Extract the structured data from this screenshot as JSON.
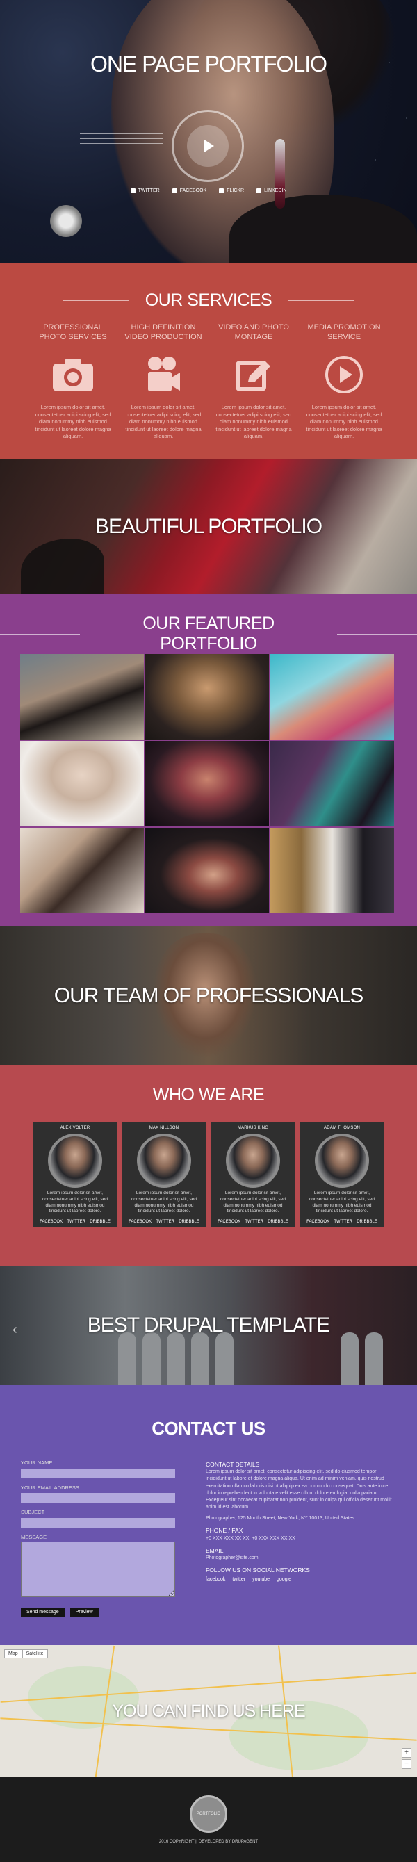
{
  "hero": {
    "title": "ONE PAGE PORTFOLIO",
    "social": [
      {
        "label": "TWITTER",
        "icon": "twitter-icon"
      },
      {
        "label": "FACEBOOK",
        "icon": "facebook-icon"
      },
      {
        "label": "FLICKR",
        "icon": "flickr-icon"
      },
      {
        "label": "LINKEDIN",
        "icon": "linkedin-icon"
      }
    ]
  },
  "services": {
    "title": "OUR SERVICES",
    "items": [
      {
        "title": "PROFESSIONAL PHOTO SERVICES",
        "icon": "camera-icon",
        "text": "Lorem ipsum dolor sit amet, consectetuer adipi scing elit, sed diam nonummy nibh euismod tincidunt ut laoreet dolore magna aliquam."
      },
      {
        "title": "HIGH DEFINITION VIDEO PRODUCTION",
        "icon": "video-camera-icon",
        "text": "Lorem ipsum dolor sit amet, consectetuer adipi scing elit, sed diam nonummy nibh euismod tincidunt ut laoreet dolore magna aliquam."
      },
      {
        "title": "VIDEO AND PHOTO MONTAGE",
        "icon": "edit-icon",
        "text": "Lorem ipsum dolor sit amet, consectetuer adipi scing elit, sed diam nonummy nibh euismod tincidunt ut laoreet dolore magna aliquam."
      },
      {
        "title": "MEDIA PROMOTION SERVICE",
        "icon": "play-circle-icon",
        "text": "Lorem ipsum dolor sit amet, consectetuer adipi scing elit, sed diam nonummy nibh euismod tincidunt ut laoreet dolore magna aliquam."
      }
    ]
  },
  "banners": {
    "portfolio": "BEAUTIFUL PORTFOLIO",
    "team": "OUR TEAM OF PROFESSIONALS",
    "drupal": "BEST DRUPAL TEMPLATE",
    "map": "YOU CAN FIND US HERE"
  },
  "featured": {
    "title": "OUR FEATURED PORTFOLIO"
  },
  "who": {
    "title": "WHO WE ARE",
    "members": [
      {
        "name": "ALEX VOLTER",
        "text": "Lorem ipsum dolor sit amet, consectetuer adipi scing elit, sed diam nonummy nibh euismod tincidunt ut laoreet dolore.",
        "links": [
          "FACEBOOK",
          "TWITTER",
          "DRIBBBLE"
        ]
      },
      {
        "name": "MAX NILLSON",
        "text": "Lorem ipsum dolor sit amet, consectetuer adipi scing elit, sed diam nonummy nibh euismod tincidunt ut laoreet dolore.",
        "links": [
          "FACEBOOK",
          "TWITTER",
          "DRIBBBLE"
        ]
      },
      {
        "name": "MARKUS KING",
        "text": "Lorem ipsum dolor sit amet, consectetuer adipi scing elit, sed diam nonummy nibh euismod tincidunt ut laoreet dolore.",
        "links": [
          "FACEBOOK",
          "TWITTER",
          "DRIBBBLE"
        ]
      },
      {
        "name": "ADAM THOMSON",
        "text": "Lorem ipsum dolor sit amet, consectetuer adipi scing elit, sed diam nonummy nibh euismod tincidunt ut laoreet dolore.",
        "links": [
          "FACEBOOK",
          "TWITTER",
          "DRIBBBLE"
        ]
      }
    ]
  },
  "contact": {
    "title": "CONTACT US",
    "form": {
      "name_label": "YOUR NAME",
      "email_label": "YOUR EMAIL ADDRESS",
      "subject_label": "SUBJECT",
      "message_label": "MESSAGE",
      "send_label": "Send message",
      "preview_label": "Preview"
    },
    "details_title": "CONTACT DETAILS",
    "details_text": "Lorem ipsum dolor sit amet, consectetur adipiscing elit, sed do eiusmod tempor incididunt ut labore et dolore magna aliqua. Ut enim ad minim veniam, quis nostrud exercitation ullamco laboris nisi ut aliquip ex ea commodo consequat. Duis aute irure dolor in reprehenderit in voluptate velit esse cillum dolore eu fugiat nulla pariatur. Excepteur sint occaecat cupidatat non proident, sunt in culpa qui officia deserunt mollit anim id est laborum.",
    "address": "Photographer, 125 Month Street, New York, NY 10013, United States",
    "phone_title": "PHONE / FAX",
    "phone": "+0 XXX XXX XX XX, +0 XXX XXX XX XX",
    "email_title": "EMAIL",
    "email": "Photographer@site.com",
    "follow_title": "FOLLOW US ON SOCIAL NETWORKS",
    "follow_links": [
      "facebook",
      "twitter",
      "youtube",
      "google"
    ]
  },
  "map": {
    "map_btn": "Map",
    "satellite_btn": "Satellite",
    "zoom_in": "+",
    "zoom_out": "−"
  },
  "footer": {
    "logo": "PORTFOLIO",
    "copyright": "2016 COPYRIGHT  ||  DEVELOPED BY DRUPAGENT"
  },
  "colors": {
    "services_bg": "#bb4a42",
    "featured_bg": "#8a3f8d",
    "who_bg": "#b74a4f",
    "contact_bg": "#6a55ae",
    "footer_bg": "#1c1c1c"
  }
}
